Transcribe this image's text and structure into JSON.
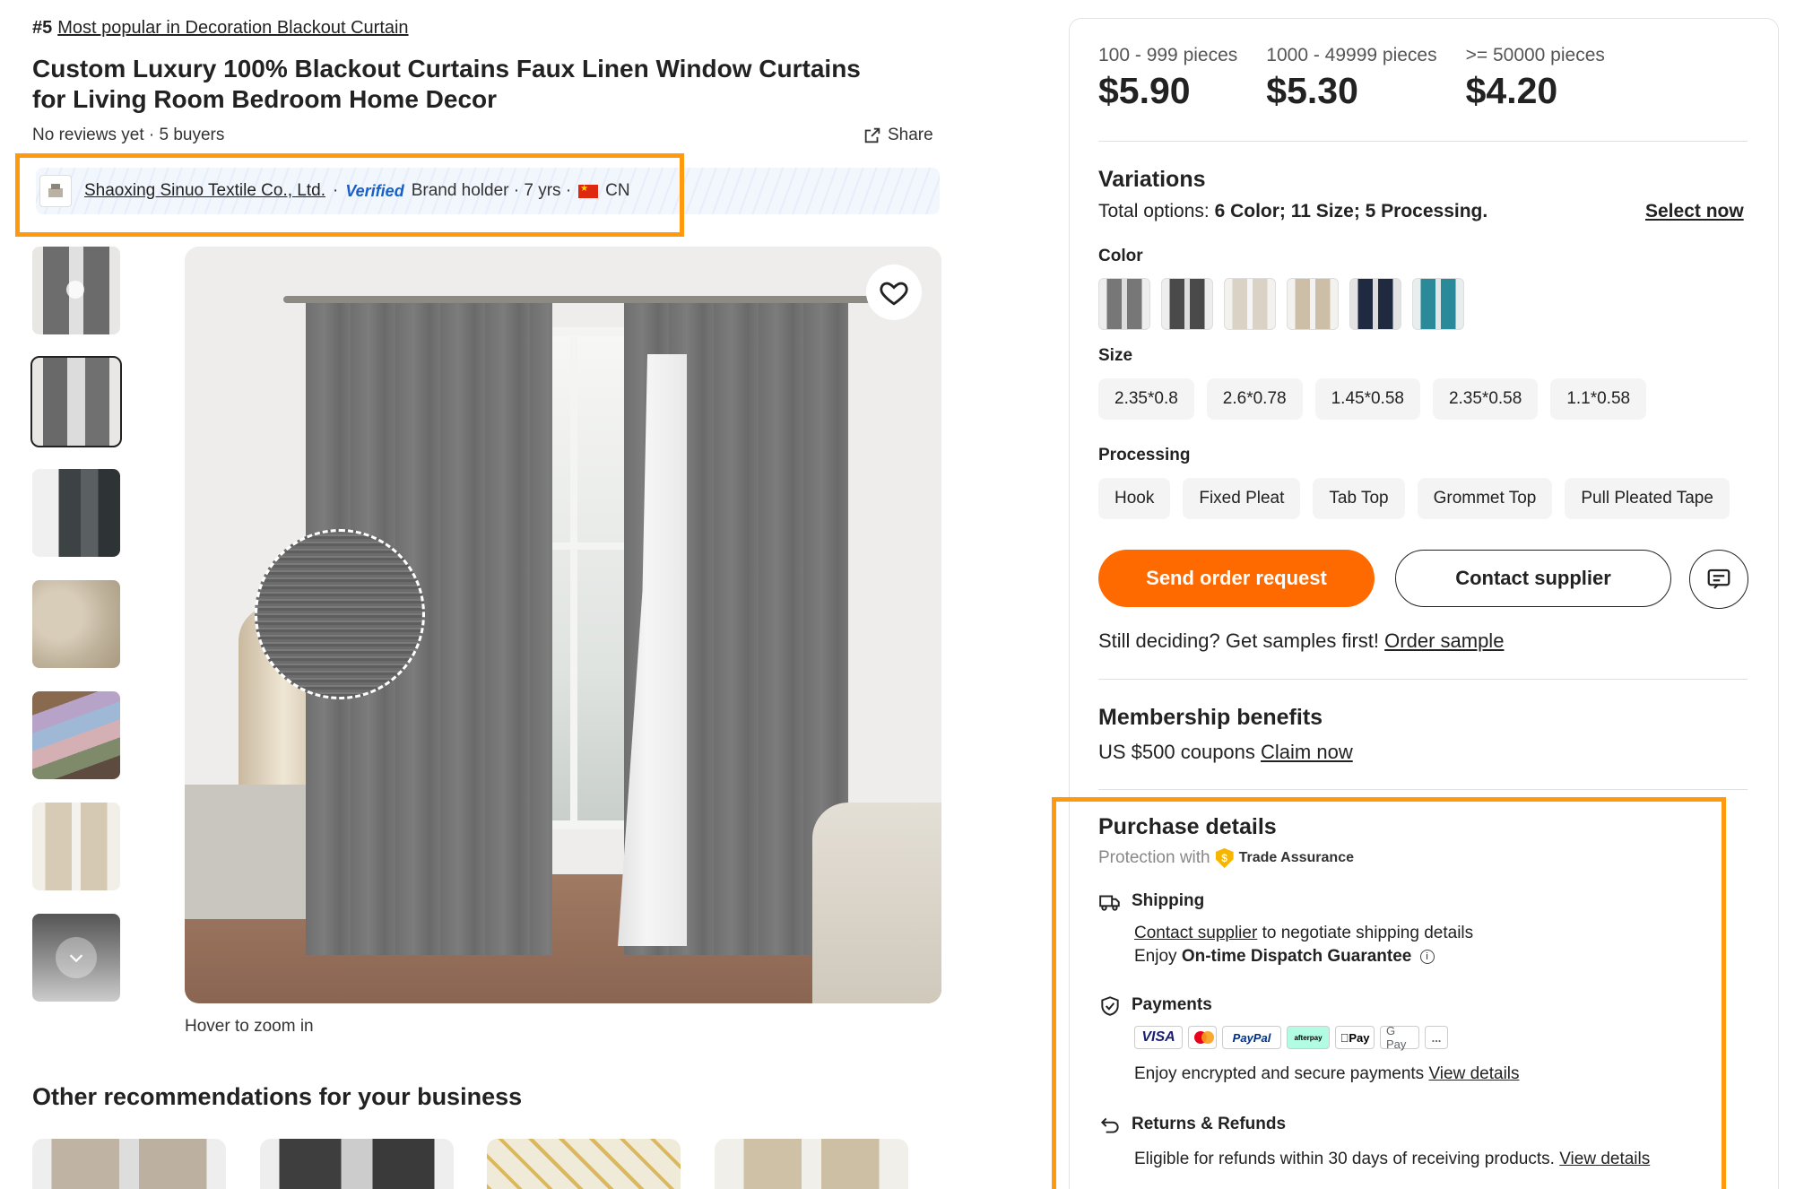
{
  "product": {
    "rank": "#5",
    "rank_label": "Most popular in Decoration Blackout Curtain",
    "title": "Custom Luxury 100% Blackout Curtains Faux Linen Window Curtains for Living Room Bedroom Home Decor",
    "reviews": "No reviews yet · 5 buyers",
    "share_label": "Share"
  },
  "supplier": {
    "name": "Shaoxing Sinuo Textile Co., Ltd.",
    "sep": "·",
    "verified": "Verified",
    "info": "Brand holder · 7 yrs ·",
    "country": "CN"
  },
  "gallery": {
    "thumbnail_count": 7,
    "selected_index": 2,
    "zoom_hint": "Hover to zoom in"
  },
  "recommendations": {
    "title": "Other recommendations for your business"
  },
  "pricing": {
    "tiers": [
      {
        "qty": "100 - 999 pieces",
        "price": "$5.90"
      },
      {
        "qty": "1000 - 49999 pieces",
        "price": "$5.30"
      },
      {
        "qty": ">= 50000 pieces",
        "price": "$4.20"
      }
    ]
  },
  "variations": {
    "title": "Variations",
    "total_prefix": "Total options:",
    "total_value": "6 Color; 11 Size; 5 Processing.",
    "select_now": "Select now",
    "color_label": "Color",
    "size_label": "Size",
    "sizes": [
      "2.35*0.8",
      "2.6*0.78",
      "1.45*0.58",
      "2.35*0.58",
      "1.1*0.58"
    ],
    "processing_label": "Processing",
    "processing": [
      "Hook",
      "Fixed Pleat",
      "Tab Top",
      "Grommet Top",
      "Pull Pleated Tape"
    ]
  },
  "actions": {
    "send_order": "Send order request",
    "contact_supplier": "Contact supplier",
    "samples_text": "Still deciding? Get samples first!",
    "order_sample": "Order sample"
  },
  "membership": {
    "title": "Membership benefits",
    "coupon_text": "US $500 coupons",
    "claim": "Claim now"
  },
  "purchase_details": {
    "title": "Purchase details",
    "protection_prefix": "Protection with",
    "trade_assurance": "Trade Assurance",
    "shipping_title": "Shipping",
    "shipping_link": "Contact supplier",
    "shipping_text": "to negotiate shipping details",
    "dispatch_prefix": "Enjoy",
    "dispatch_bold": "On-time Dispatch Guarantee",
    "payments_title": "Payments",
    "payment_methods": [
      "VISA",
      "Mastercard",
      "PayPal",
      "afterpay",
      "Pay",
      "G Pay",
      "..."
    ],
    "payments_text": "Enjoy encrypted and secure payments",
    "payments_link": "View details",
    "returns_title": "Returns & Refunds",
    "returns_text": "Eligible for refunds within 30 days of receiving products.",
    "returns_link": "View details"
  },
  "colors": {
    "accent": "#ff6a00",
    "highlight": "#ff9a0f",
    "verified_blue": "#1860c7"
  }
}
